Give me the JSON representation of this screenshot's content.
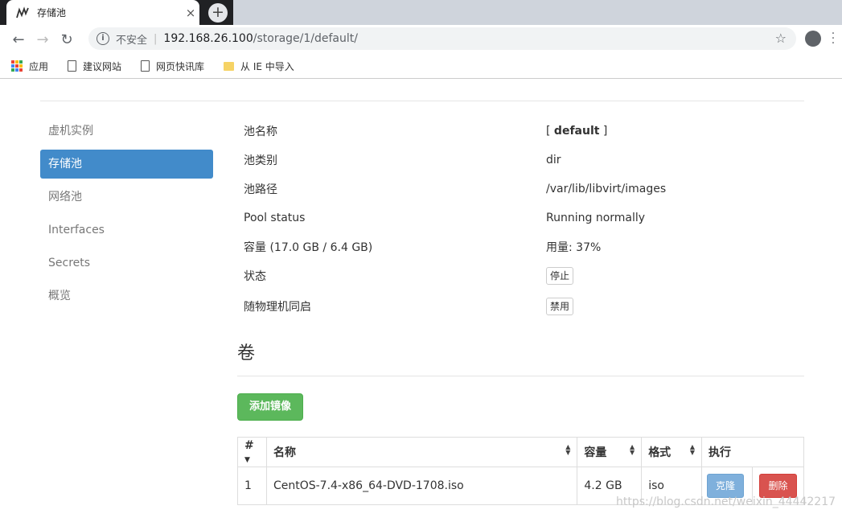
{
  "browser": {
    "tab_title": "存储池",
    "security_label": "不安全",
    "url_host": "192.168.26.100",
    "url_path": "/storage/1/default/",
    "bookmarks": [
      "应用",
      "建议网站",
      "网页快讯库",
      "从 IE 中导入"
    ]
  },
  "sidebar": {
    "items": [
      {
        "label": "虚机实例",
        "active": false
      },
      {
        "label": "存储池",
        "active": true
      },
      {
        "label": "网络池",
        "active": false
      },
      {
        "label": "Interfaces",
        "active": false
      },
      {
        "label": "Secrets",
        "active": false
      },
      {
        "label": "概览",
        "active": false
      }
    ]
  },
  "pool": {
    "name_label": "池名称",
    "name_open": "[",
    "name_value": "default",
    "name_close": "]",
    "type_label": "池类别",
    "type_value": "dir",
    "path_label": "池路径",
    "path_value": "/var/lib/libvirt/images",
    "status_label": "Pool status",
    "status_value": "Running normally",
    "capacity_label": "容量 (17.0 GB / 6.4 GB)",
    "usage_value": "用量: 37%",
    "state_label": "状态",
    "stop_button": "停止",
    "autostart_label": "随物理机同启",
    "disable_button": "禁用"
  },
  "volumes": {
    "heading": "卷",
    "add_button": "添加镜像",
    "columns": [
      "#",
      "名称",
      "容量",
      "格式",
      "执行"
    ],
    "rows": [
      {
        "index": "1",
        "name": "CentOS-7.4-x86_64-DVD-1708.iso",
        "size": "4.2 GB",
        "format": "iso",
        "clone": "克隆",
        "delete": "删除"
      }
    ]
  },
  "watermark": "https://blog.csdn.net/weixin_44442217"
}
